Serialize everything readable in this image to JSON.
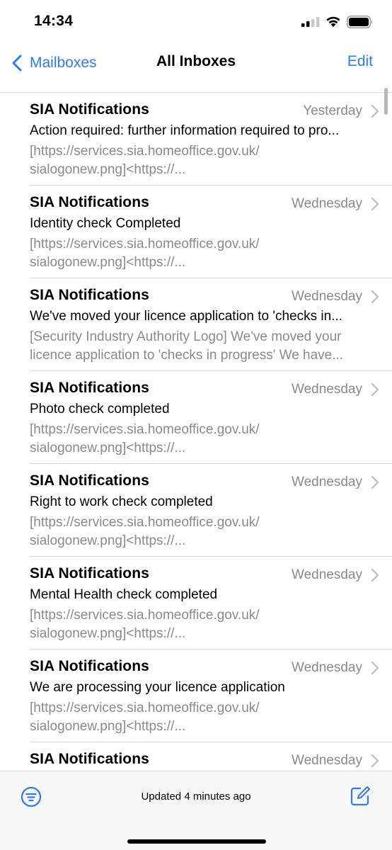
{
  "status_bar": {
    "time": "14:34"
  },
  "nav": {
    "back_label": "Mailboxes",
    "title": "All Inboxes",
    "edit_label": "Edit"
  },
  "messages": [
    {
      "sender": "SIA Notifications",
      "date": "Yesterday",
      "subject": "Action required: further information required to pro...",
      "preview_line1": "[https://services.sia.homeoffice.gov.uk/",
      "preview_line2": "sialogonew.png]<https://..."
    },
    {
      "sender": "SIA Notifications",
      "date": "Wednesday",
      "subject": "Identity check Completed",
      "preview_line1": "[https://services.sia.homeoffice.gov.uk/",
      "preview_line2": "sialogonew.png]<https://..."
    },
    {
      "sender": "SIA Notifications",
      "date": "Wednesday",
      "subject": "We've moved your licence application to 'checks in...",
      "preview_line1": "[Security Industry Authority Logo] We've moved your",
      "preview_line2": "licence application to 'checks in progress' We have..."
    },
    {
      "sender": "SIA Notifications",
      "date": "Wednesday",
      "subject": "Photo check completed",
      "preview_line1": "[https://services.sia.homeoffice.gov.uk/",
      "preview_line2": "sialogonew.png]<https://..."
    },
    {
      "sender": "SIA Notifications",
      "date": "Wednesday",
      "subject": "Right to work check completed",
      "preview_line1": "[https://services.sia.homeoffice.gov.uk/",
      "preview_line2": "sialogonew.png]<https://..."
    },
    {
      "sender": "SIA Notifications",
      "date": "Wednesday",
      "subject": "Mental Health check completed",
      "preview_line1": "[https://services.sia.homeoffice.gov.uk/",
      "preview_line2": "sialogonew.png]<https://..."
    },
    {
      "sender": "SIA Notifications",
      "date": "Wednesday",
      "subject": "We are processing your licence application",
      "preview_line1": "[https://services.sia.homeoffice.gov.uk/",
      "preview_line2": "sialogonew.png]<https://..."
    },
    {
      "sender": "SIA Notifications",
      "date": "Wednesday",
      "subject": "",
      "preview_line1": "",
      "preview_line2": ""
    }
  ],
  "toolbar": {
    "status_text": "Updated 4 minutes ago"
  },
  "icons": {
    "signal": "cellular-signal-icon",
    "wifi": "wifi-icon",
    "battery": "battery-icon",
    "back": "chevron-left-icon",
    "row": "chevron-right-icon",
    "filter": "filter-icon",
    "compose": "compose-icon"
  },
  "colors": {
    "accent": "#2f7bf6",
    "secondary_text": "#8a8a8e"
  }
}
